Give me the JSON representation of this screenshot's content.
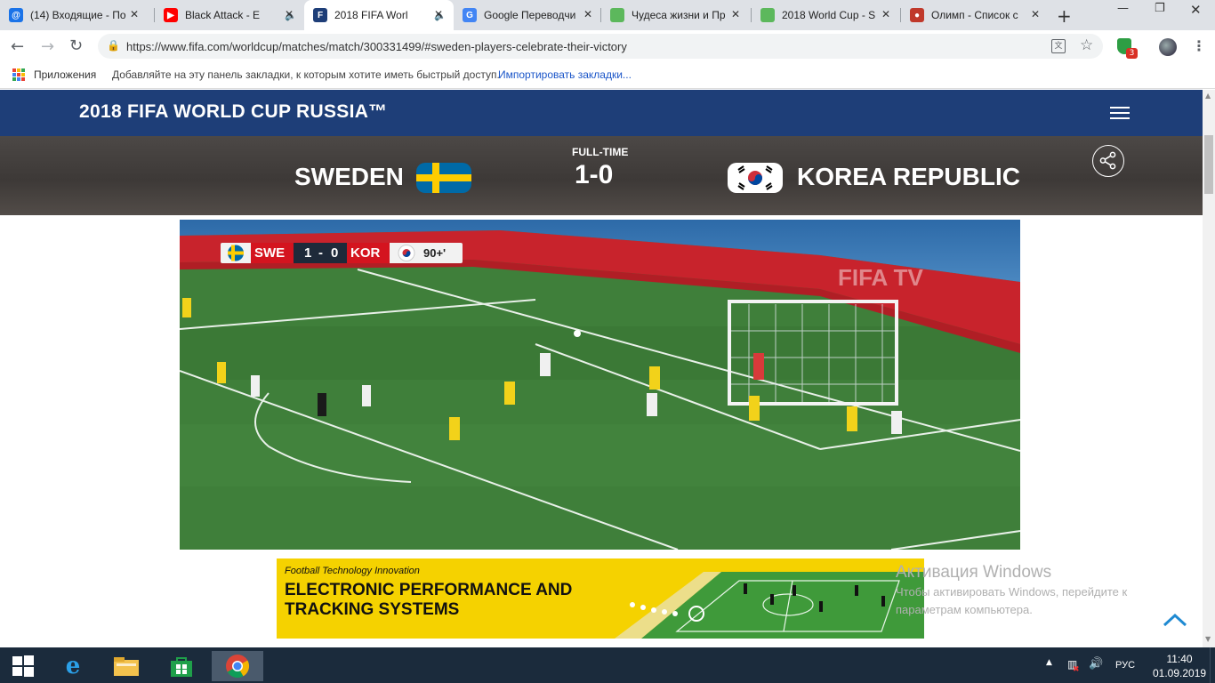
{
  "browser": {
    "tabs": [
      {
        "title": "(14) Входящие - По",
        "favicon_color": "#1a73e8",
        "favicon_glyph": "@",
        "audio": false
      },
      {
        "title": "Black Attack - E",
        "favicon_color": "#ff0000",
        "favicon_glyph": "▶",
        "audio": true
      },
      {
        "title": "2018 FIFA Worl",
        "favicon_color": "#1e3e78",
        "favicon_glyph": "F",
        "audio": true
      },
      {
        "title": "Google Переводчи",
        "favicon_color": "#4285f4",
        "favicon_glyph": "G",
        "audio": false
      },
      {
        "title": "Чудеса жизни и Пр",
        "favicon_color": "#5cb85c",
        "favicon_glyph": "",
        "audio": false
      },
      {
        "title": "2018 World Cup - S",
        "favicon_color": "#5cb85c",
        "favicon_glyph": "",
        "audio": false
      },
      {
        "title": "Олимп - Список с",
        "favicon_color": "#c0392b",
        "favicon_glyph": "●",
        "audio": false
      }
    ],
    "active_tab_index": 2,
    "url": "https://www.fifa.com/worldcup/matches/match/300331499/#sweden-players-celebrate-their-victory",
    "extension_badge": "3",
    "bookmarks": {
      "apps_label": "Приложения",
      "hint": "Добавляйте на эту панель закладки, к которым хотите иметь быстрый доступ.",
      "import_link": "Импортировать закладки..."
    }
  },
  "site": {
    "title": "2018 FIFA WORLD CUP RUSSIA™",
    "match": {
      "status": "FULL-TIME",
      "home_team": "SWEDEN",
      "away_team": "KOREA REPUBLIC",
      "score": "1-0"
    },
    "video_overlay": {
      "home_code": "SWE",
      "away_code": "KOR",
      "home_score": "1",
      "away_score": "0",
      "separator": "-",
      "clock": "90+'",
      "watermark": "FIFA TV"
    },
    "ad": {
      "tagline": "Football Technology Innovation",
      "line1": "ELECTRONIC PERFORMANCE AND",
      "line2": "TRACKING SYSTEMS"
    }
  },
  "windows_watermark": {
    "title": "Активация Windows",
    "line1": "Чтобы активировать Windows, перейдите к",
    "line2": "параметрам компьютера."
  },
  "taskbar": {
    "lang": "РУС",
    "time": "11:40",
    "date": "01.09.2019"
  }
}
